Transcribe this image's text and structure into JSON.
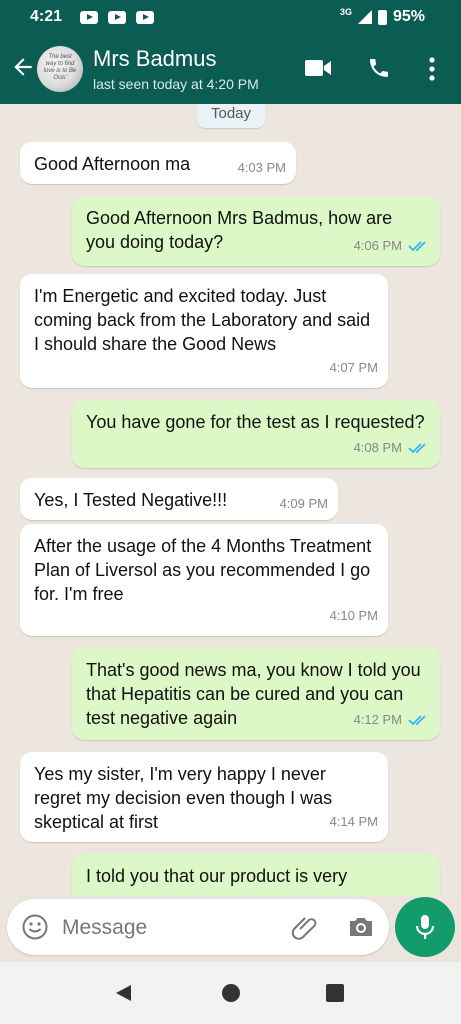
{
  "status_bar": {
    "time": "4:21",
    "network": "3G",
    "battery": "95%"
  },
  "header": {
    "contact_name": "Mrs Badmus",
    "last_seen": "last seen today at 4:20 PM",
    "avatar_text": "The best way to find love is to Be Ocis'",
    "icons": [
      "back-arrow-icon",
      "video-call-icon",
      "phone-icon",
      "more-vert-icon"
    ]
  },
  "chat": {
    "date_chip": "Today",
    "messages": [
      {
        "dir": "in",
        "text": "Good Afternoon ma",
        "time": "4:03 PM"
      },
      {
        "dir": "out",
        "text": "Good Afternoon Mrs Badmus, how are you doing today?",
        "time": "4:06 PM",
        "read": true
      },
      {
        "dir": "in",
        "text": "I'm Energetic and excited today. Just coming back from the Laboratory and said I should share the Good News",
        "time": "4:07 PM"
      },
      {
        "dir": "out",
        "text": "You have gone for the test as I requested?",
        "time": "4:08 PM",
        "read": true
      },
      {
        "dir": "in",
        "text": "Yes, I  Tested Negative!!!",
        "time": "4:09 PM"
      },
      {
        "dir": "in",
        "text": "After the usage of the 4 Months Treatment Plan of Liversol as you recommended I go for. I'm free",
        "time": "4:10 PM"
      },
      {
        "dir": "out",
        "text": "That's good news ma, you know I told you that Hepatitis can be cured and you can test negative again",
        "time": "4:12 PM",
        "read": true
      },
      {
        "dir": "in",
        "text": "Yes my sister, I'm very happy I never regret my decision even though I was skeptical at first",
        "time": "4:14 PM"
      },
      {
        "dir": "out",
        "text": "I told you that our product is very",
        "time": "",
        "read": false
      }
    ]
  },
  "composer": {
    "placeholder": "Message",
    "icons": [
      "emoji-icon",
      "attach-icon",
      "camera-icon",
      "mic-icon"
    ]
  },
  "colors": {
    "header": "#0b5c52",
    "outgoing_bubble": "#dcf8c6",
    "incoming_bubble": "#ffffff",
    "read_tick": "#34b7f1",
    "mic_button": "#129b6b"
  }
}
